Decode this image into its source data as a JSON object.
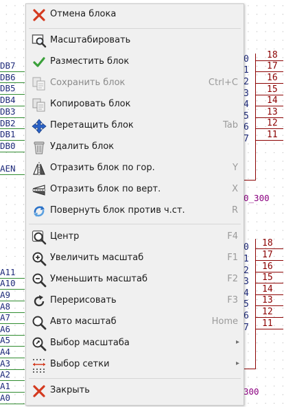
{
  "schematic": {
    "left_labels": [
      "DB7",
      "DB6",
      "DB5",
      "DB4",
      "DB3",
      "DB2",
      "DB1",
      "DB0"
    ],
    "enable_label": "AEN",
    "addr_labels": [
      "A11",
      "A10",
      "A9",
      "A8",
      "A7",
      "A6",
      "A5",
      "A4",
      "A3",
      "A2",
      "A1",
      "A0"
    ],
    "chip1_left_pins": [
      "0",
      "1",
      "2",
      "3",
      "4",
      "5",
      "6",
      "7"
    ],
    "chip1_right_pins": [
      "18",
      "17",
      "16",
      "15",
      "14",
      "13",
      "12",
      "11"
    ],
    "chip1_caption": "0_300",
    "chip2_left_pins": [
      "0",
      "1",
      "2",
      "3",
      "4",
      "5",
      "6",
      "7"
    ],
    "chip2_right_pins": [
      "18",
      "17",
      "16",
      "15",
      "14",
      "13",
      "12",
      "11"
    ],
    "chip2_caption": "300"
  },
  "menu": {
    "items": [
      {
        "label": "Отмена блока",
        "shortcut": "",
        "icon": "cancel-x-icon",
        "disabled": false,
        "submenu": false
      },
      {
        "label": "Масштабировать",
        "shortcut": "",
        "icon": "zoom-area-icon",
        "disabled": false,
        "submenu": false
      },
      {
        "label": "Разместить блок",
        "shortcut": "",
        "icon": "checkmark-icon",
        "disabled": false,
        "submenu": false
      },
      {
        "label": "Сохранить блок",
        "shortcut": "Ctrl+C",
        "icon": "copy-save-icon",
        "disabled": true,
        "submenu": false
      },
      {
        "label": "Копировать блок",
        "shortcut": "",
        "icon": "copy-block-icon",
        "disabled": false,
        "submenu": false
      },
      {
        "label": "Перетащить блок",
        "shortcut": "Tab",
        "icon": "move-arrows-icon",
        "disabled": false,
        "submenu": false
      },
      {
        "label": "Удалить блок",
        "shortcut": "",
        "icon": "trash-icon",
        "disabled": false,
        "submenu": false
      },
      {
        "label": "Отразить блок по гор.",
        "shortcut": "Y",
        "icon": "mirror-horizontal-icon",
        "disabled": false,
        "submenu": false
      },
      {
        "label": "Отразить блок по верт.",
        "shortcut": "X",
        "icon": "mirror-vertical-icon",
        "disabled": false,
        "submenu": false
      },
      {
        "label": "Повернуть блок против ч.ст.",
        "shortcut": "R",
        "icon": "rotate-ccw-icon",
        "disabled": false,
        "submenu": false
      },
      {
        "label": "Центр",
        "shortcut": "F4",
        "icon": "zoom-center-icon",
        "disabled": false,
        "submenu": false
      },
      {
        "label": "Увеличить масштаб",
        "shortcut": "F1",
        "icon": "zoom-in-icon",
        "disabled": false,
        "submenu": false
      },
      {
        "label": "Уменьшить масштаб",
        "shortcut": "F2",
        "icon": "zoom-out-icon",
        "disabled": false,
        "submenu": false
      },
      {
        "label": "Перерисовать",
        "shortcut": "F3",
        "icon": "redraw-icon",
        "disabled": false,
        "submenu": false
      },
      {
        "label": "Авто масштаб",
        "shortcut": "Home",
        "icon": "zoom-fit-icon",
        "disabled": false,
        "submenu": false
      },
      {
        "label": "Выбор масштаба",
        "shortcut": "",
        "icon": "zoom-select-icon",
        "disabled": false,
        "submenu": true
      },
      {
        "label": "Выбор сетки",
        "shortcut": "",
        "icon": "grid-select-icon",
        "disabled": false,
        "submenu": true
      },
      {
        "label": "Закрыть",
        "shortcut": "",
        "icon": "close-x-icon",
        "disabled": false,
        "submenu": false
      }
    ],
    "submenu_arrow": "▸",
    "colors": {
      "accent_red": "#d43a1f",
      "check_green": "#3aa03a",
      "move_blue": "#2a62c8"
    }
  }
}
